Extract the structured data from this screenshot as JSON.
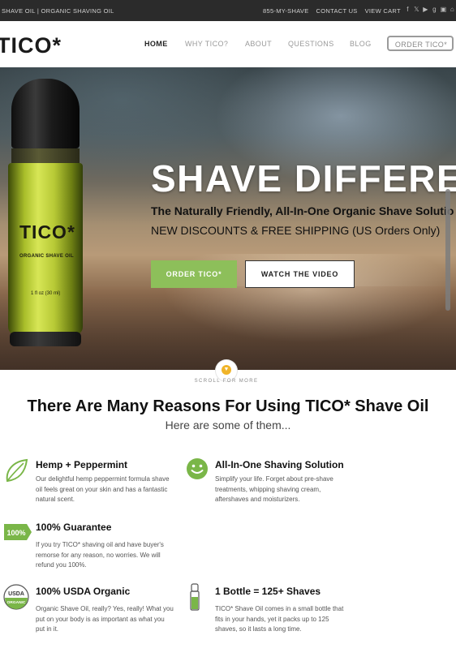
{
  "topbar": {
    "tagline": "SHAVE OIL | ORGANIC SHAVING OIL",
    "links": [
      "855-MY-SHAVE",
      "CONTACT US",
      "VIEW CART"
    ],
    "social_icons": [
      "facebook-icon",
      "twitter-icon",
      "youtube-icon",
      "google-plus-icon",
      "instagram-icon",
      "home-icon"
    ]
  },
  "header": {
    "logo": "TICO*",
    "nav": [
      "HOME",
      "WHY TICO?",
      "ABOUT",
      "QUESTIONS",
      "BLOG"
    ],
    "active_nav": "HOME",
    "order_button": "ORDER TICO*"
  },
  "hero": {
    "bottle_brand": "TICO*",
    "bottle_sub": "ORGANIC SHAVE OIL",
    "bottle_volume": "1 fl oz (30 ml)",
    "headline": "SHAVE DIFFERE",
    "subheadline": "The Naturally Friendly, All-In-One Organic Shave Solutio",
    "promo": "NEW DISCOUNTS & FREE SHIPPING (US Orders Only)",
    "order_button": "ORDER TICO*",
    "video_button": "WATCH THE VIDEO",
    "scroll_label": "SCROLL FOR MORE"
  },
  "reasons": {
    "title": "There Are Many Reasons For Using TICO* Shave Oil",
    "subtitle": "Here are some of them...",
    "items": [
      {
        "title": "Hemp + Peppermint",
        "text": "Our delightful hemp peppermint formula shave oil feels great on your skin and has a fantastic natural scent.",
        "icon": "leaf-icon"
      },
      {
        "title": "All-In-One Shaving Solution",
        "text": "Simplify your life. Forget about pre-shave treatments, whipping shaving cream, aftershaves and moisturizers.",
        "icon": "smiley-icon"
      },
      {
        "title": "100% Guarantee",
        "text": "If you try TICO* shaving oil and have buyer's remorse for any reason, no worries. We will refund you 100%.",
        "icon": "guarantee-tag-icon",
        "icon_text": "100%"
      },
      {
        "title": "100% USDA Organic",
        "text": "Organic Shave Oil, really? Yes, really! What you put on your body is as important as what you put in it.",
        "icon": "usda-organic-seal-icon",
        "icon_text_top": "USDA",
        "icon_text_bottom": "ORGANIC"
      },
      {
        "title": "1 Bottle = 125+ Shaves",
        "text": "TICO* Shave Oil comes in a small bottle that fits in your hands, yet it packs up to 125 shaves, so it lasts a long time.",
        "icon": "bottle-icon"
      }
    ]
  },
  "colors": {
    "accent_green": "#8dbf5a",
    "topbar": "#2b2b2b",
    "scroll_dot": "#f0b429"
  }
}
